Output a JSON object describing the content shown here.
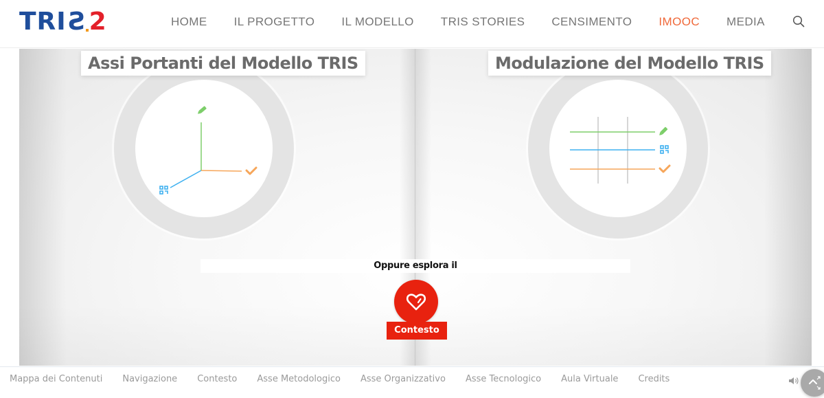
{
  "header": {
    "logo": {
      "text_main": "TRI",
      "text_mirrored": "S",
      "text_number": "2",
      "alt": "TRIS2"
    },
    "nav": [
      {
        "label": "HOME",
        "active": false
      },
      {
        "label": "IL PROGETTO",
        "active": false
      },
      {
        "label": "IL MODELLO",
        "active": false
      },
      {
        "label": "TRIS STORIES",
        "active": false
      },
      {
        "label": "CENSIMENTO",
        "active": false
      },
      {
        "label": "IMOOC",
        "active": true
      },
      {
        "label": "MEDIA",
        "active": false
      }
    ],
    "search_icon": "search-icon"
  },
  "stage": {
    "left_panel": {
      "title": "Assi Portanti del Modello TRIS",
      "icons": [
        "pencil-icon",
        "check-icon",
        "qr-grid-icon"
      ]
    },
    "right_panel": {
      "title": "Modulazione del Modello TRIS",
      "icons": [
        "pencil-icon",
        "qr-grid-icon",
        "check-icon"
      ]
    },
    "explore_text": "Oppure esplora il",
    "contesto_button": {
      "label": "Contesto",
      "icon": "heart-icon"
    }
  },
  "colors": {
    "brand_blue": "#1f4e9c",
    "brand_red": "#e3202a",
    "nav_active": "#f0693a",
    "axis_green": "#7dce6a",
    "axis_blue": "#3fb1f0",
    "axis_orange": "#f6a65a",
    "contesto_red": "#e8220f"
  },
  "footer": {
    "links": [
      "Mappa dei Contenuti",
      "Navigazione",
      "Contesto",
      "Asse Metodologico",
      "Asse Organizzativo",
      "Asse Tecnologico",
      "Aula Virtuale",
      "Credits"
    ],
    "sound_icon": "speaker-icon",
    "fab_icon": "fullscreen-toggle-icon"
  }
}
